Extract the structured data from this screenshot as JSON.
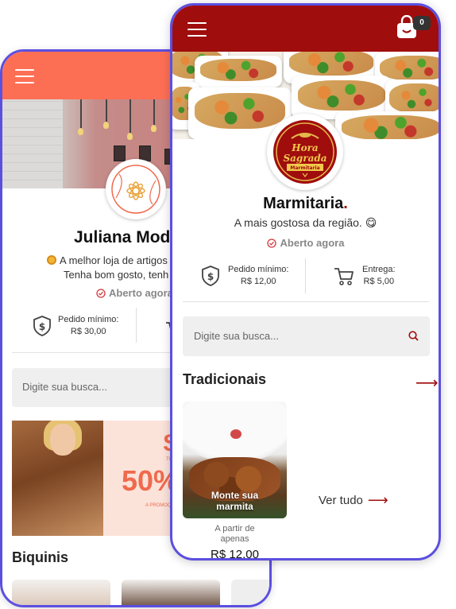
{
  "back_store": {
    "name": "Juliana Mod",
    "description_line1": "A melhor loja de artigos",
    "description_line2": "Tenha bom gosto, tenh",
    "status": "Aberto agora",
    "min_order_label": "Pedido mínimo:",
    "min_order_value": "R$ 30,00",
    "search_placeholder": "Digite sua busca...",
    "promo_percent": "50%",
    "promo_letter": "S",
    "promo_small_top": "TO",
    "promo_small_bottom": "A PROMOÇ",
    "section_title": "Biquinis",
    "logo_text_top": "BEAUTY",
    "logo_text_side": "BOUTIQUE",
    "accent_color": "#fd6f55"
  },
  "front_store": {
    "name": "Marmitaria",
    "name_dot": ".",
    "description": "A mais gostosa da região. 😋",
    "status": "Aberto agora",
    "min_order_label": "Pedido mínimo:",
    "min_order_value": "R$ 12,00",
    "delivery_label": "Entrega:",
    "delivery_value": "R$ 5,00",
    "search_placeholder": "Digite sua busca...",
    "cart_count": "0",
    "section_title": "Tradicionais",
    "section_arrow": "⟶",
    "product": {
      "name_line1": "Monte sua",
      "name_line2": "marmita",
      "price_prefix_line1": "A partir de",
      "price_prefix_line2": "apenas",
      "price": "R$ 12,00"
    },
    "see_all_label": "Ver tudo",
    "see_all_arrow": "⟶",
    "logo_line1": "Hora",
    "logo_line2": "Sagrada",
    "logo_line3": "Marmitaria",
    "accent_color": "#a00d0d"
  },
  "icons": {
    "menu": "hamburger-icon",
    "cart": "shopping-bag-icon",
    "shield": "shield-dollar-icon",
    "delivery": "cart-icon",
    "search": "search-icon",
    "clock": "check-circle-icon"
  }
}
